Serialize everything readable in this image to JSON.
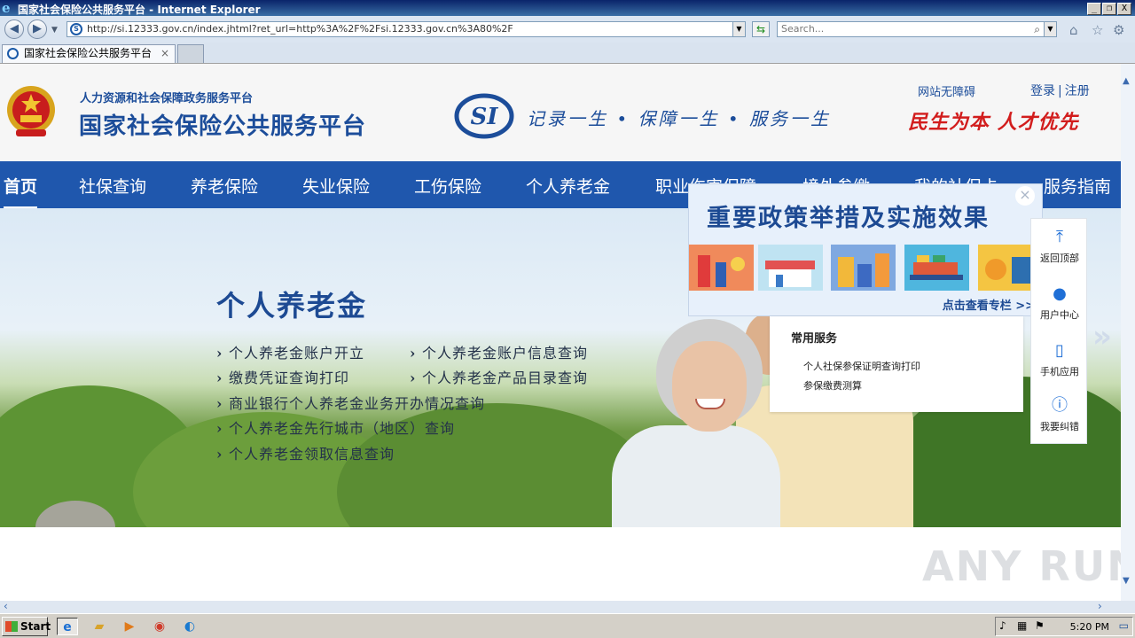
{
  "window": {
    "title": "国家社会保险公共服务平台 - Internet Explorer",
    "buttons": [
      "_",
      "❐",
      "X"
    ]
  },
  "addressbar": {
    "url": "http://si.12333.gov.cn/index.jhtml?ret_url=http%3A%2F%2Fsi.12333.gov.cn%3A80%2F",
    "search_placeholder": "Search..."
  },
  "tabs": [
    {
      "label": "国家社会保险公共服务平台",
      "close": "×"
    }
  ],
  "header": {
    "sub_title": "人力资源和社会保障政务服务平台",
    "main_title": "国家社会保险公共服务平台",
    "slogan": "记录一生 • 保障一生 • 服务一生",
    "accessible": "网站无障碍",
    "login": "登录",
    "separator": "|",
    "register": "注册",
    "motto": "民生为本 人才优先",
    "si_logo_text": "SI"
  },
  "nav": {
    "items": [
      "首页",
      "社保查询",
      "养老保险",
      "失业保险",
      "工伤保险",
      "个人养老金",
      "职业伤害保障",
      "境外参缴",
      "我的社保卡",
      "服务指南"
    ],
    "active_index": 0
  },
  "banner": {
    "title": "个人养老金",
    "links": [
      "个人养老金账户开立",
      "个人养老金账户信息查询",
      "缴费凭证查询打印",
      "个人养老金产品目录查询",
      "商业银行个人养老金业务开办情况查询",
      "个人养老金先行城市（地区）查询",
      "个人养老金领取信息查询"
    ]
  },
  "policy_popup": {
    "title": "重要政策举措及实施效果",
    "more": "点击查看专栏 >>",
    "close": "×"
  },
  "services": {
    "title": "常用服务",
    "items": [
      "个人社保参保证明查询打印",
      "参保缴费测算"
    ]
  },
  "float_bar": {
    "items": [
      {
        "label": "返回顶部",
        "icon": "arrow-up-icon"
      },
      {
        "label": "用户中心",
        "icon": "user-icon"
      },
      {
        "label": "手机应用",
        "icon": "mobile-icon"
      },
      {
        "label": "我要纠错",
        "icon": "alert-icon"
      }
    ]
  },
  "watermark": "ANY RUN",
  "taskbar": {
    "start": "Start",
    "clock": "5:20 PM"
  },
  "colors": {
    "nav_blue": "#1f57ad",
    "title_blue": "#1c4d9a",
    "motto_red": "#d21d1d"
  }
}
